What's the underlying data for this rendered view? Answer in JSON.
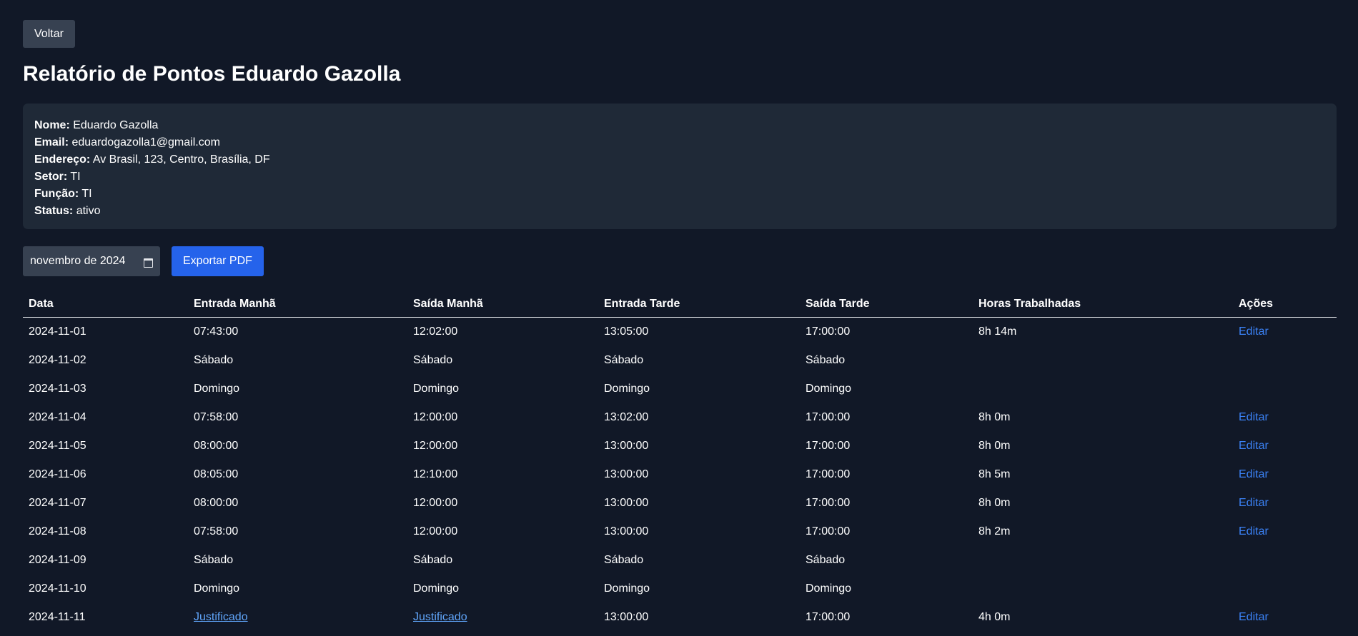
{
  "back_button": "Voltar",
  "page_title": "Relatório de Pontos Eduardo Gazolla",
  "info": [
    {
      "label": "Nome:",
      "value": "Eduardo Gazolla"
    },
    {
      "label": "Email:",
      "value": "eduardogazolla1@gmail.com"
    },
    {
      "label": "Endereço:",
      "value": "Av Brasil, 123, Centro, Brasília, DF"
    },
    {
      "label": "Setor:",
      "value": "TI"
    },
    {
      "label": "Função:",
      "value": "TI"
    },
    {
      "label": "Status:",
      "value": "ativo"
    }
  ],
  "month_input": {
    "value": "novembro de 2024",
    "icon": "calendar-icon"
  },
  "export_button": "Exportar PDF",
  "table": {
    "headers": [
      "Data",
      "Entrada Manhã",
      "Saída Manhã",
      "Entrada Tarde",
      "Saída Tarde",
      "Horas Trabalhadas",
      "Ações"
    ],
    "rows": [
      {
        "date": "2024-11-01",
        "em": "07:43:00",
        "sm": "12:02:00",
        "et": "13:05:00",
        "st": "17:00:00",
        "hours": "8h 14m",
        "action": "Editar"
      },
      {
        "date": "2024-11-02",
        "em": "Sábado",
        "sm": "Sábado",
        "et": "Sábado",
        "st": "Sábado",
        "hours": "",
        "action": ""
      },
      {
        "date": "2024-11-03",
        "em": "Domingo",
        "sm": "Domingo",
        "et": "Domingo",
        "st": "Domingo",
        "hours": "",
        "action": ""
      },
      {
        "date": "2024-11-04",
        "em": "07:58:00",
        "sm": "12:00:00",
        "et": "13:02:00",
        "st": "17:00:00",
        "hours": "8h 0m",
        "action": "Editar"
      },
      {
        "date": "2024-11-05",
        "em": "08:00:00",
        "sm": "12:00:00",
        "et": "13:00:00",
        "st": "17:00:00",
        "hours": "8h 0m",
        "action": "Editar"
      },
      {
        "date": "2024-11-06",
        "em": "08:05:00",
        "sm": "12:10:00",
        "et": "13:00:00",
        "st": "17:00:00",
        "hours": "8h 5m",
        "action": "Editar"
      },
      {
        "date": "2024-11-07",
        "em": "08:00:00",
        "sm": "12:00:00",
        "et": "13:00:00",
        "st": "17:00:00",
        "hours": "8h 0m",
        "action": "Editar"
      },
      {
        "date": "2024-11-08",
        "em": "07:58:00",
        "sm": "12:00:00",
        "et": "13:00:00",
        "st": "17:00:00",
        "hours": "8h 2m",
        "action": "Editar"
      },
      {
        "date": "2024-11-09",
        "em": "Sábado",
        "sm": "Sábado",
        "et": "Sábado",
        "st": "Sábado",
        "hours": "",
        "action": ""
      },
      {
        "date": "2024-11-10",
        "em": "Domingo",
        "sm": "Domingo",
        "et": "Domingo",
        "st": "Domingo",
        "hours": "",
        "action": ""
      },
      {
        "date": "2024-11-11",
        "em": "Justificado",
        "sm": "Justificado",
        "et": "13:00:00",
        "st": "17:00:00",
        "hours": "4h 0m",
        "action": "Editar"
      }
    ]
  }
}
